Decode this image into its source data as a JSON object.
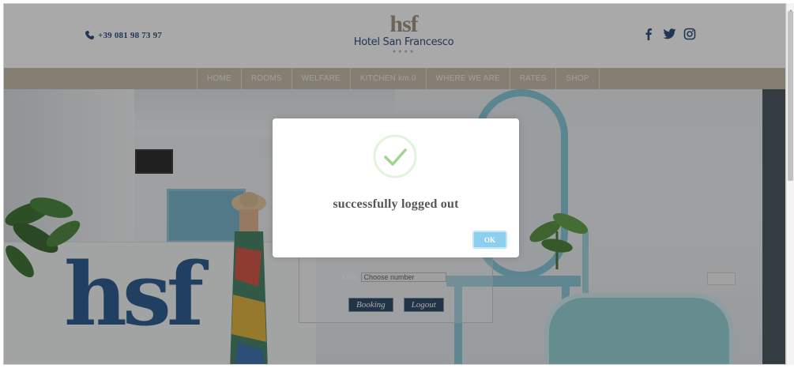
{
  "header": {
    "phone": "+39 081 98 73 97",
    "logo_mark": "hsf",
    "logo_name": "Hotel San Francesco",
    "logo_stars": "★★★★",
    "social_icons": [
      "facebook-icon",
      "twitter-icon",
      "instagram-icon"
    ]
  },
  "nav": {
    "items": [
      {
        "label": "HOME"
      },
      {
        "label": "ROOMS"
      },
      {
        "label": "WELFARE"
      },
      {
        "label": "KITCHEN km.0"
      },
      {
        "label": "WHERE WE ARE"
      },
      {
        "label": "RATES"
      },
      {
        "label": "SHOP"
      }
    ]
  },
  "hero": {
    "desk_logo": "hsf"
  },
  "booking": {
    "kids_label": "Kids",
    "kids_value": "Choose number",
    "booking_button": "Booking",
    "logout_button": "Logout"
  },
  "modal": {
    "title": "successfully logged out",
    "ok_label": "OK"
  },
  "colors": {
    "brand_blue": "#1d3f72",
    "nav_bg": "#c4b7a6",
    "success_green": "#9fd68f",
    "ok_button": "#8ccfee"
  }
}
